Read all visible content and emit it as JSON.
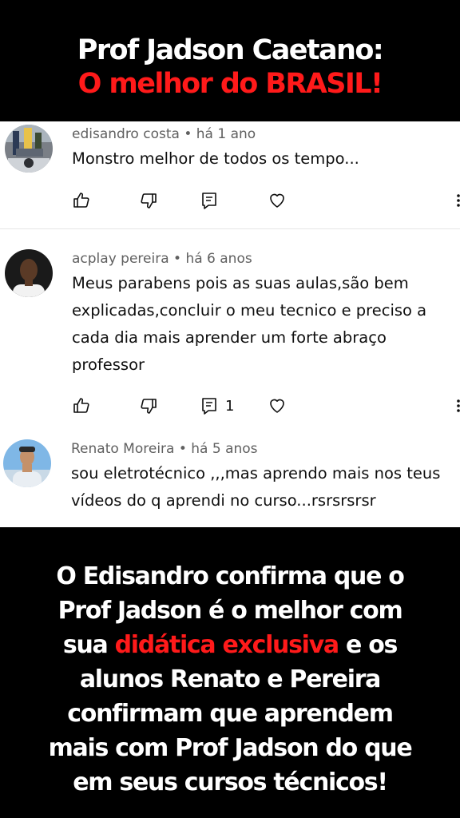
{
  "banner": {
    "line1": "Prof Jadson Caetano:",
    "line2": "O melhor do BRASIL!",
    "line1_color": "#ffffff",
    "line2_color": "#ff1a1a"
  },
  "comments": [
    {
      "author_meta": "edisandro costa • há 1 ano",
      "text": "Monstro  melhor de todos os tempo...",
      "reply_count": ""
    },
    {
      "author_meta": "acplay pereira • há 6 anos",
      "text": "Meus parabens pois as suas aulas,são bem explicadas,concluir o meu tecnico e preciso a cada dia mais aprender um forte abraço professor",
      "reply_count": "1"
    },
    {
      "author_meta": "Renato Moreira • há 5 anos",
      "text": "sou eletrotécnico ,,,mas aprendo mais nos teus vídeos do q aprendi no curso...rsrsrsrsr"
    }
  ],
  "icons": {
    "like": "thumbs-up-icon",
    "dislike": "thumbs-down-icon",
    "reply": "reply-comment-icon",
    "heart": "heart-icon",
    "more": "more-vertical-icon"
  },
  "bottom": {
    "line1": "O Edisandro confirma que o",
    "line2": "Prof Jadson é o melhor com",
    "line3_pre": "sua ",
    "line3_highlight": "didática exclusiva",
    "line3_post": " e os",
    "line4": "alunos Renato e Pereira",
    "line5": "confirmam que aprendem",
    "line6": "mais com Prof Jadson do que",
    "line7": "em seus cursos técnicos!",
    "highlight_color": "#ff1a1a"
  }
}
